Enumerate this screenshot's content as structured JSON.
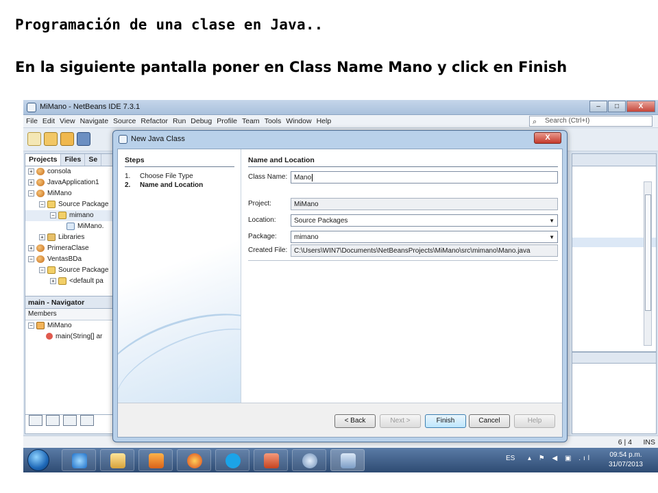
{
  "slide": {
    "title": "Programación de una clase en Java..",
    "subtitle": "En la siguiente pantalla poner en Class Name Mano y click en Finish"
  },
  "window": {
    "title": "MiMano - NetBeans IDE 7.3.1",
    "menu": [
      "File",
      "Edit",
      "View",
      "Navigate",
      "Source",
      "Refactor",
      "Run",
      "Debug",
      "Profile",
      "Team",
      "Tools",
      "Window",
      "Help"
    ],
    "search_placeholder": "Search (Ctrl+I)",
    "min": "–",
    "max": "□",
    "close": "X"
  },
  "projects_pane": {
    "tabs": [
      "Projects",
      "Files",
      "Se"
    ],
    "tree": [
      {
        "label": "consola",
        "icon": "project-icon"
      },
      {
        "label": "JavaApplication1",
        "icon": "project-icon"
      },
      {
        "label": "MiMano",
        "icon": "project-icon"
      },
      {
        "label": "Source Package",
        "icon": "package-folder-icon"
      },
      {
        "label": "mimano",
        "icon": "package-icon"
      },
      {
        "label": "MiMano.",
        "icon": "java-file-icon"
      },
      {
        "label": "Libraries",
        "icon": "library-icon"
      },
      {
        "label": "PrimeraClase",
        "icon": "project-icon"
      },
      {
        "label": "VentasBDa",
        "icon": "project-icon"
      },
      {
        "label": "Source Package",
        "icon": "package-folder-icon"
      },
      {
        "label": "<default pa",
        "icon": "package-icon"
      }
    ]
  },
  "navigator": {
    "title": "main - Navigator",
    "members_label": "Members",
    "class_name": "MiMano",
    "method": "main(String[] ar"
  },
  "statusbar": {
    "position": "6 | 4",
    "mode": "INS"
  },
  "taskbar": {
    "lang": "ES",
    "tray_icons": "▴ ⚑ ◀ ▣ .ıl",
    "time": "09:54 p.m.",
    "date": "31/07/2013"
  },
  "dialog": {
    "title": "New Java Class",
    "close": "X",
    "steps_heading": "Steps",
    "steps": [
      {
        "num": "1.",
        "label": "Choose File Type"
      },
      {
        "num": "2.",
        "label": "Name and Location"
      }
    ],
    "section_heading": "Name and Location",
    "class_name_label": "Class Name:",
    "class_name_value": "Mano",
    "project_label": "Project:",
    "project_value": "MiMano",
    "location_label": "Location:",
    "location_value": "Source Packages",
    "package_label": "Package:",
    "package_value": "mimano",
    "created_file_label": "Created File:",
    "created_file_value": "C:\\Users\\WIN7\\Documents\\NetBeansProjects\\MiMano\\src\\mimano\\Mano.java",
    "buttons": {
      "back": "< Back",
      "next": "Next >",
      "finish": "Finish",
      "cancel": "Cancel",
      "help": "Help"
    }
  }
}
